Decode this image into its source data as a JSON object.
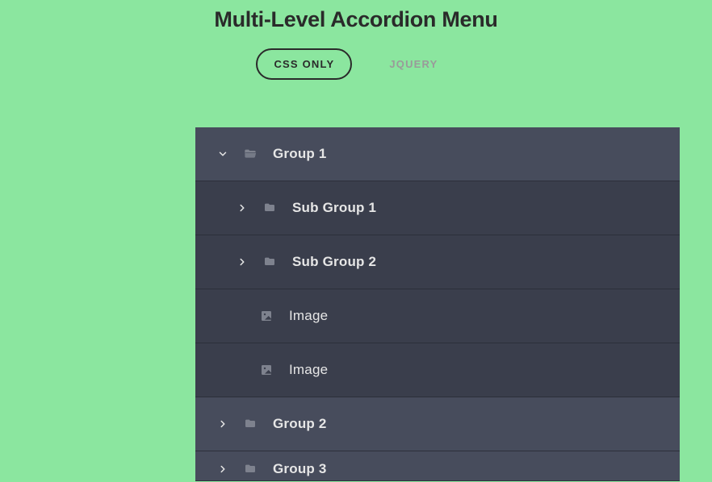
{
  "header": {
    "title": "Multi-Level Accordion Menu",
    "tabs": {
      "css_only": "CSS ONLY",
      "jquery": "JQUERY"
    }
  },
  "menu": {
    "group1": {
      "label": "Group 1",
      "sub1": {
        "label": "Sub Group 1"
      },
      "sub2": {
        "label": "Sub Group 2",
        "image1": "Image",
        "image2": "Image"
      }
    },
    "group2": {
      "label": "Group 2"
    },
    "group3": {
      "label": "Group 3"
    }
  }
}
